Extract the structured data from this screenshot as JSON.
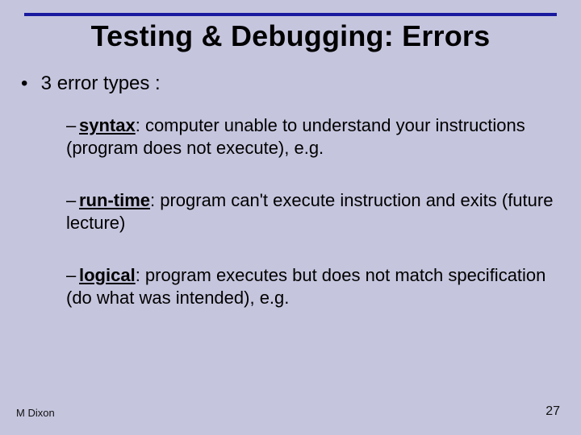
{
  "title": "Testing & Debugging: Errors",
  "intro": "3 error types :",
  "items": [
    {
      "term": "syntax",
      "rest": ": computer unable to understand your instructions (program does not execute), e.g."
    },
    {
      "term": "run-time",
      "rest": ": program can't execute instruction and exits (future lecture)"
    },
    {
      "term": "logical",
      "rest": ": program executes but does not match specification (do what was intended), e.g."
    }
  ],
  "footer": {
    "author": "M Dixon",
    "page": "27"
  }
}
